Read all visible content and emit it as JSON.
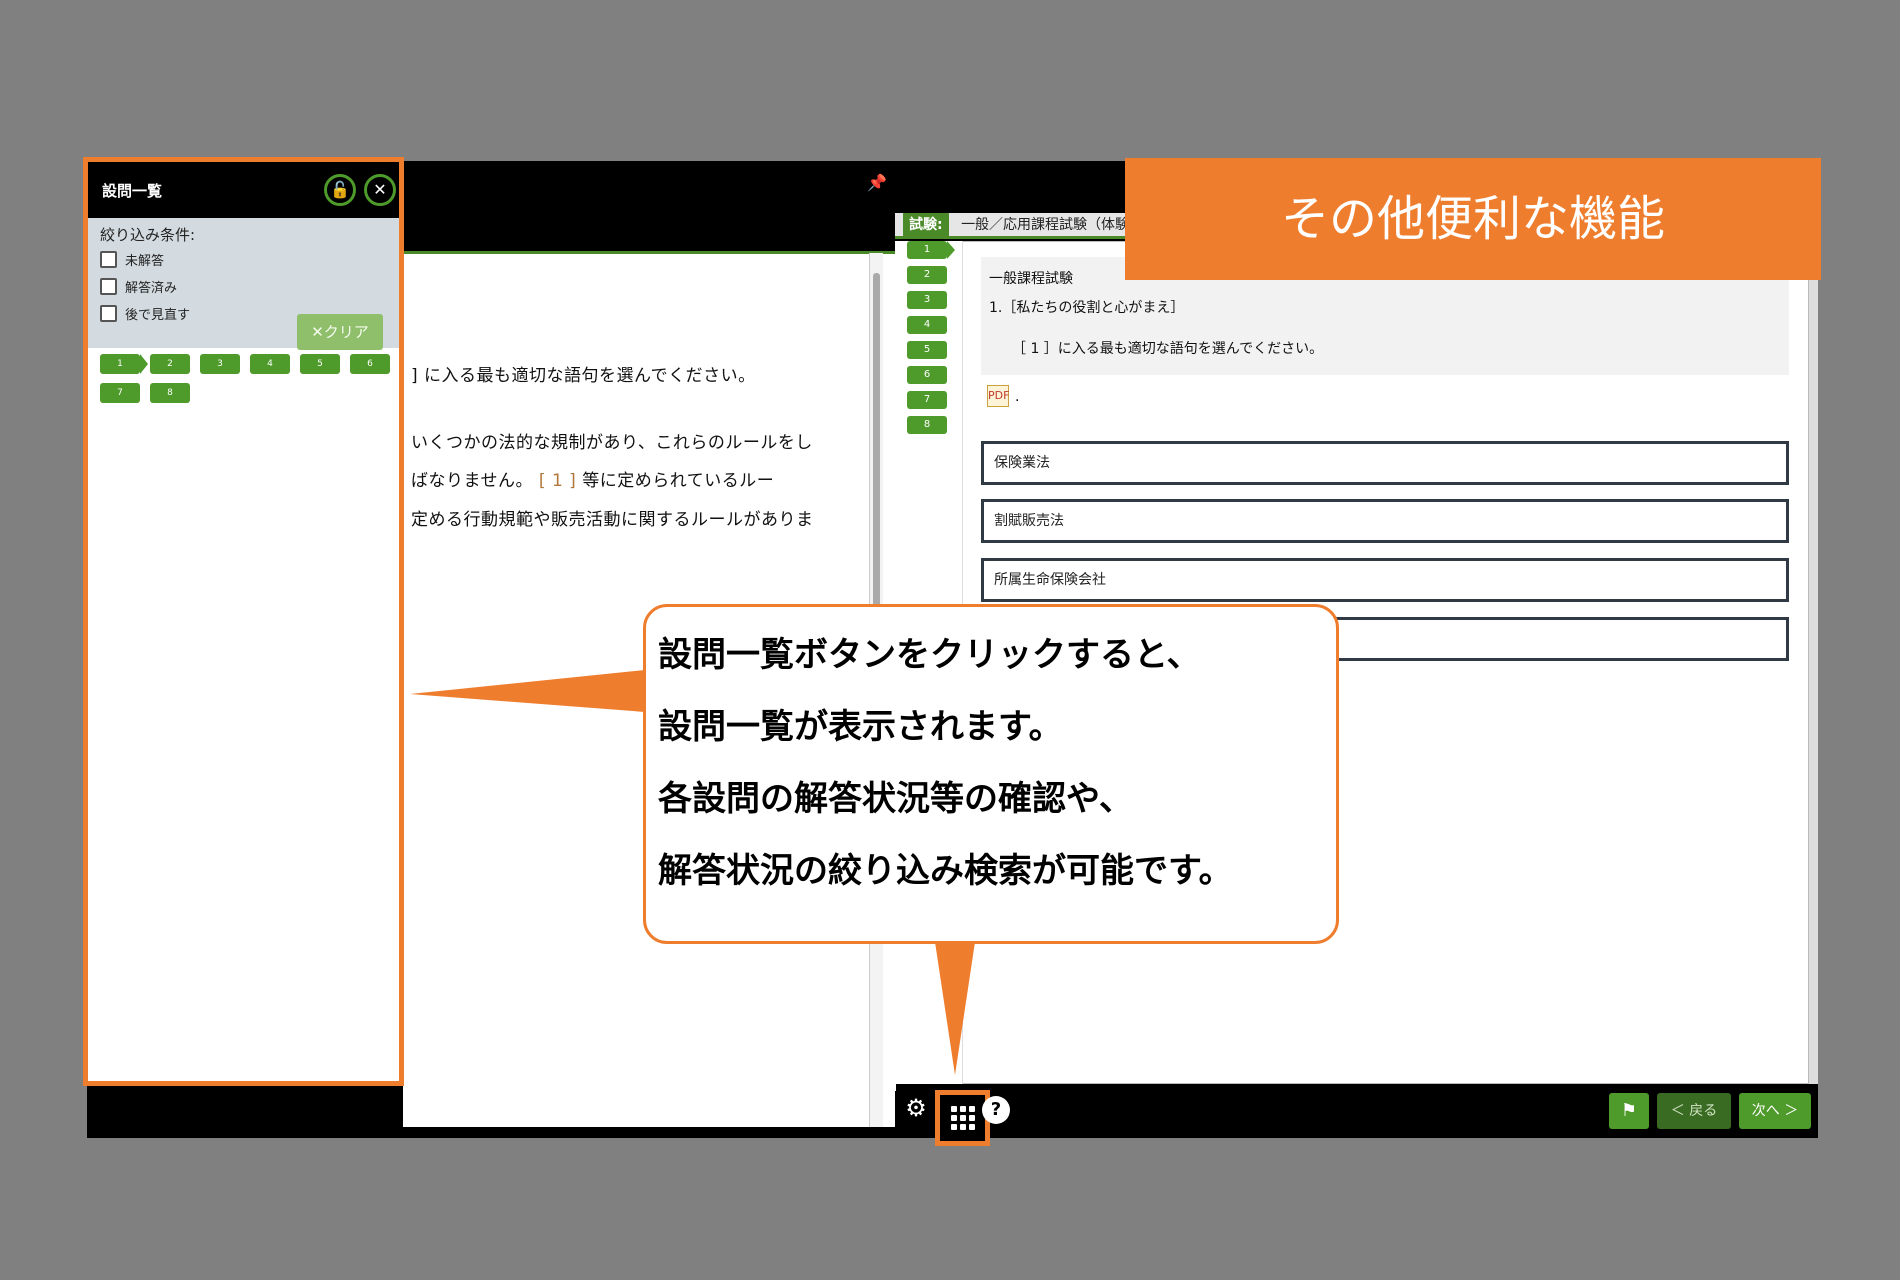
{
  "banner": {
    "title": "その他便利な機能"
  },
  "question_list_panel": {
    "title": "設問一覧",
    "lock_icon": "unlock-icon",
    "close_icon": "close-icon",
    "filter_title": "絞り込み条件:",
    "filters": [
      "未解答",
      "解答済み",
      "後で見直す"
    ],
    "clear_label": "✕クリア",
    "questions": [
      "1",
      "2",
      "3",
      "4",
      "5",
      "6",
      "7",
      "8"
    ]
  },
  "text_pane": {
    "lines": [
      "] に入る最も適切な語句を選んでください。",
      "いくつかの法的な規制があり、これらのルールをし",
      "ばなりません。",
      "定める行動規範や販売活動に関するルールがありま"
    ],
    "blank": "[ 1 ]",
    "line2_tail": "等に定められているルー"
  },
  "question_pane": {
    "header_label": "試験:",
    "header_text": "一般／応用課程試験（体験",
    "nav": [
      "1",
      "2",
      "3",
      "4",
      "5",
      "6",
      "7",
      "8"
    ],
    "exam_name": "一般課程試験",
    "question_title": "1.［私たちの役割と心がまえ］",
    "question_prompt": "［ 1 ］に入る最も適切な語句を選んでください。",
    "pdf_suffix": ".",
    "choices": [
      "保険業法",
      "割賦販売法",
      "所属生命保険会社",
      ""
    ]
  },
  "toolbar": {
    "settings_icon": "gear-icon",
    "list_icon": "grid-icon",
    "help_label": "?",
    "flag_icon": "flag-icon",
    "prev_label": "＜ 戻る",
    "next_label": "次へ ＞"
  },
  "callout": {
    "lines": [
      "設問一覧ボタンをクリックすると、",
      "設問一覧が表示されます。",
      "各設問の解答状況等の確認や、",
      "解答状況の絞り込み検索が可能です。"
    ]
  }
}
